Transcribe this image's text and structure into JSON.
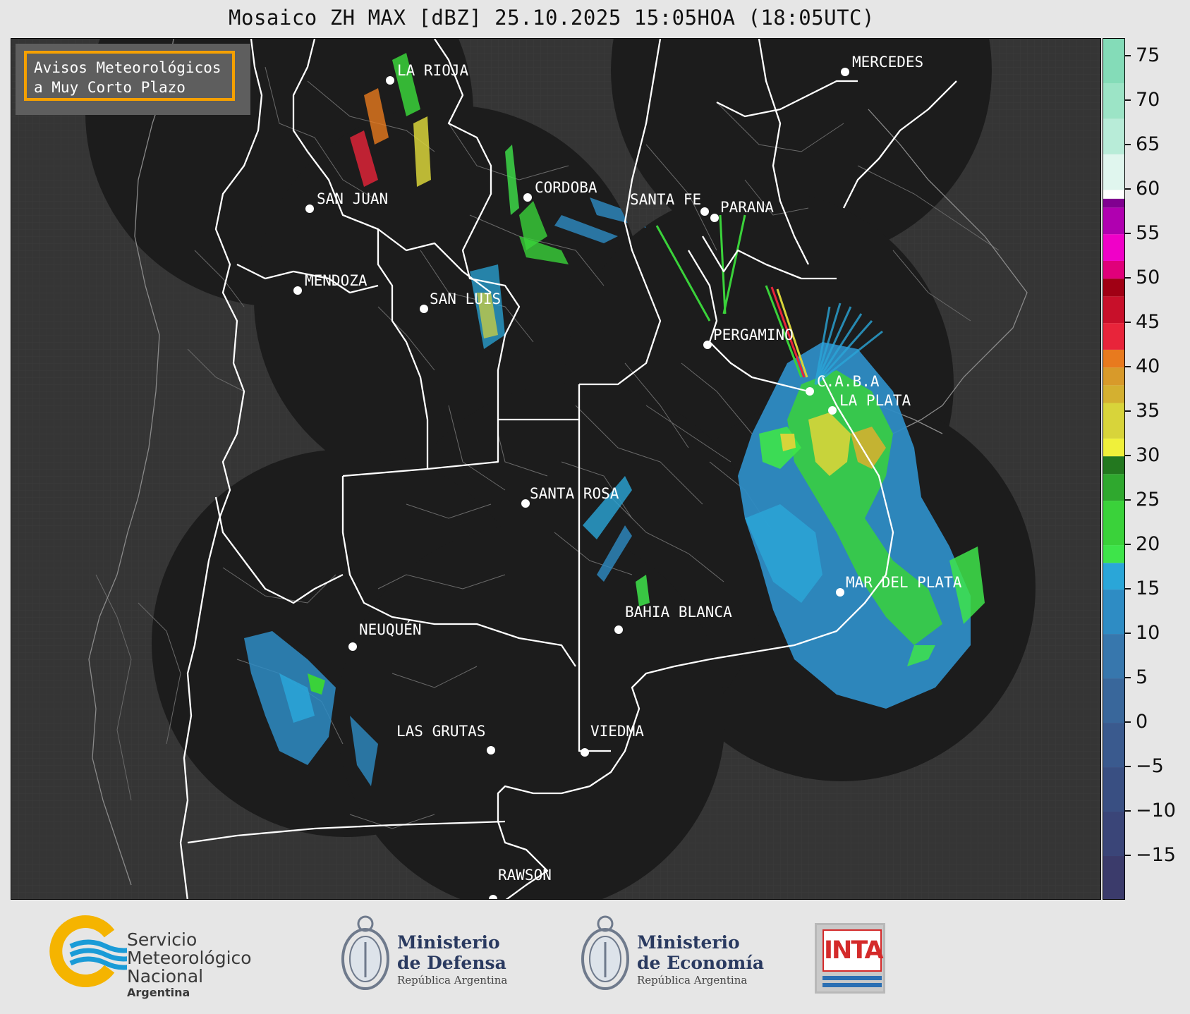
{
  "title": "Mosaico ZH MAX [dBZ] 25.10.2025 15:05HOA (18:05UTC)",
  "notice": {
    "line1": "Avisos Meteorológicos",
    "line2": "a Muy Corto Plazo"
  },
  "colors": {
    "background_map": "#353535",
    "radar_coverage": "#1c1c1c",
    "borders": "#ffffff",
    "notice_border": "#f5a000"
  },
  "cities": [
    {
      "name": "LA RIOJA"
    },
    {
      "name": "MERCEDES"
    },
    {
      "name": "CORDOBA"
    },
    {
      "name": "SAN JUAN"
    },
    {
      "name": "SANTA FE"
    },
    {
      "name": "PARANA"
    },
    {
      "name": "MENDOZA"
    },
    {
      "name": "SAN LUIS"
    },
    {
      "name": "PERGAMINO"
    },
    {
      "name": "C.A.B.A"
    },
    {
      "name": "LA PLATA"
    },
    {
      "name": "SANTA ROSA"
    },
    {
      "name": "MAR DEL PLATA"
    },
    {
      "name": "BAHIA BLANCA"
    },
    {
      "name": "NEUQUÉN"
    },
    {
      "name": "LAS GRUTAS"
    },
    {
      "name": "VIEDMA"
    },
    {
      "name": "RAWSON"
    }
  ],
  "colorbar": {
    "unit": "dBZ",
    "range": [
      -20,
      77
    ],
    "ticks": [
      "75",
      "70",
      "65",
      "60",
      "55",
      "50",
      "45",
      "40",
      "35",
      "30",
      "25",
      "20",
      "15",
      "10",
      "5",
      "0",
      "−5",
      "−10",
      "−15"
    ],
    "tick_values": [
      75,
      70,
      65,
      60,
      55,
      50,
      45,
      40,
      35,
      30,
      25,
      20,
      15,
      10,
      5,
      0,
      -5,
      -10,
      -15
    ],
    "bands": [
      {
        "from": -20,
        "to": -15,
        "color": "#3b3b6b"
      },
      {
        "from": -15,
        "to": -10,
        "color": "#3a4578"
      },
      {
        "from": -10,
        "to": -5,
        "color": "#394f82"
      },
      {
        "from": -5,
        "to": 0,
        "color": "#3a5a8e"
      },
      {
        "from": 0,
        "to": 5,
        "color": "#39679b"
      },
      {
        "from": 5,
        "to": 10,
        "color": "#3777ad"
      },
      {
        "from": 10,
        "to": 15,
        "color": "#2e8cc4"
      },
      {
        "from": 15,
        "to": 18,
        "color": "#2aa6d8"
      },
      {
        "from": 18,
        "to": 20,
        "color": "#3ee44a"
      },
      {
        "from": 20,
        "to": 25,
        "color": "#3ad23a"
      },
      {
        "from": 25,
        "to": 28,
        "color": "#2fa82e"
      },
      {
        "from": 28,
        "to": 30,
        "color": "#23781f"
      },
      {
        "from": 30,
        "to": 32,
        "color": "#f0f03a"
      },
      {
        "from": 32,
        "to": 36,
        "color": "#d8d43a"
      },
      {
        "from": 36,
        "to": 38,
        "color": "#d4b030"
      },
      {
        "from": 38,
        "to": 40,
        "color": "#d89a2a"
      },
      {
        "from": 40,
        "to": 42,
        "color": "#e87a1e"
      },
      {
        "from": 42,
        "to": 45,
        "color": "#e8243a"
      },
      {
        "from": 45,
        "to": 48,
        "color": "#c8102a"
      },
      {
        "from": 48,
        "to": 50,
        "color": "#a00014"
      },
      {
        "from": 50,
        "to": 52,
        "color": "#e0007a"
      },
      {
        "from": 52,
        "to": 55,
        "color": "#f000c8"
      },
      {
        "from": 55,
        "to": 58,
        "color": "#b000b0"
      },
      {
        "from": 58,
        "to": 59,
        "color": "#800090"
      },
      {
        "from": 59,
        "to": 60,
        "color": "#ffffff"
      },
      {
        "from": 60,
        "to": 64,
        "color": "#e0f6ee"
      },
      {
        "from": 64,
        "to": 68,
        "color": "#b8ecd8"
      },
      {
        "from": 68,
        "to": 72,
        "color": "#9ce4c6"
      },
      {
        "from": 72,
        "to": 77,
        "color": "#84dcb8"
      }
    ]
  },
  "logos": {
    "smn": {
      "line1": "Servicio",
      "line2": "Meteorológico",
      "line3": "Nacional",
      "line4": "Argentina"
    },
    "defensa": {
      "line1": "Ministerio",
      "line2": "de Defensa",
      "line3": "República Argentina"
    },
    "economia": {
      "line1": "Ministerio",
      "line2": "de Economía",
      "line3": "República Argentina"
    },
    "inta": {
      "label": "INTA"
    }
  }
}
